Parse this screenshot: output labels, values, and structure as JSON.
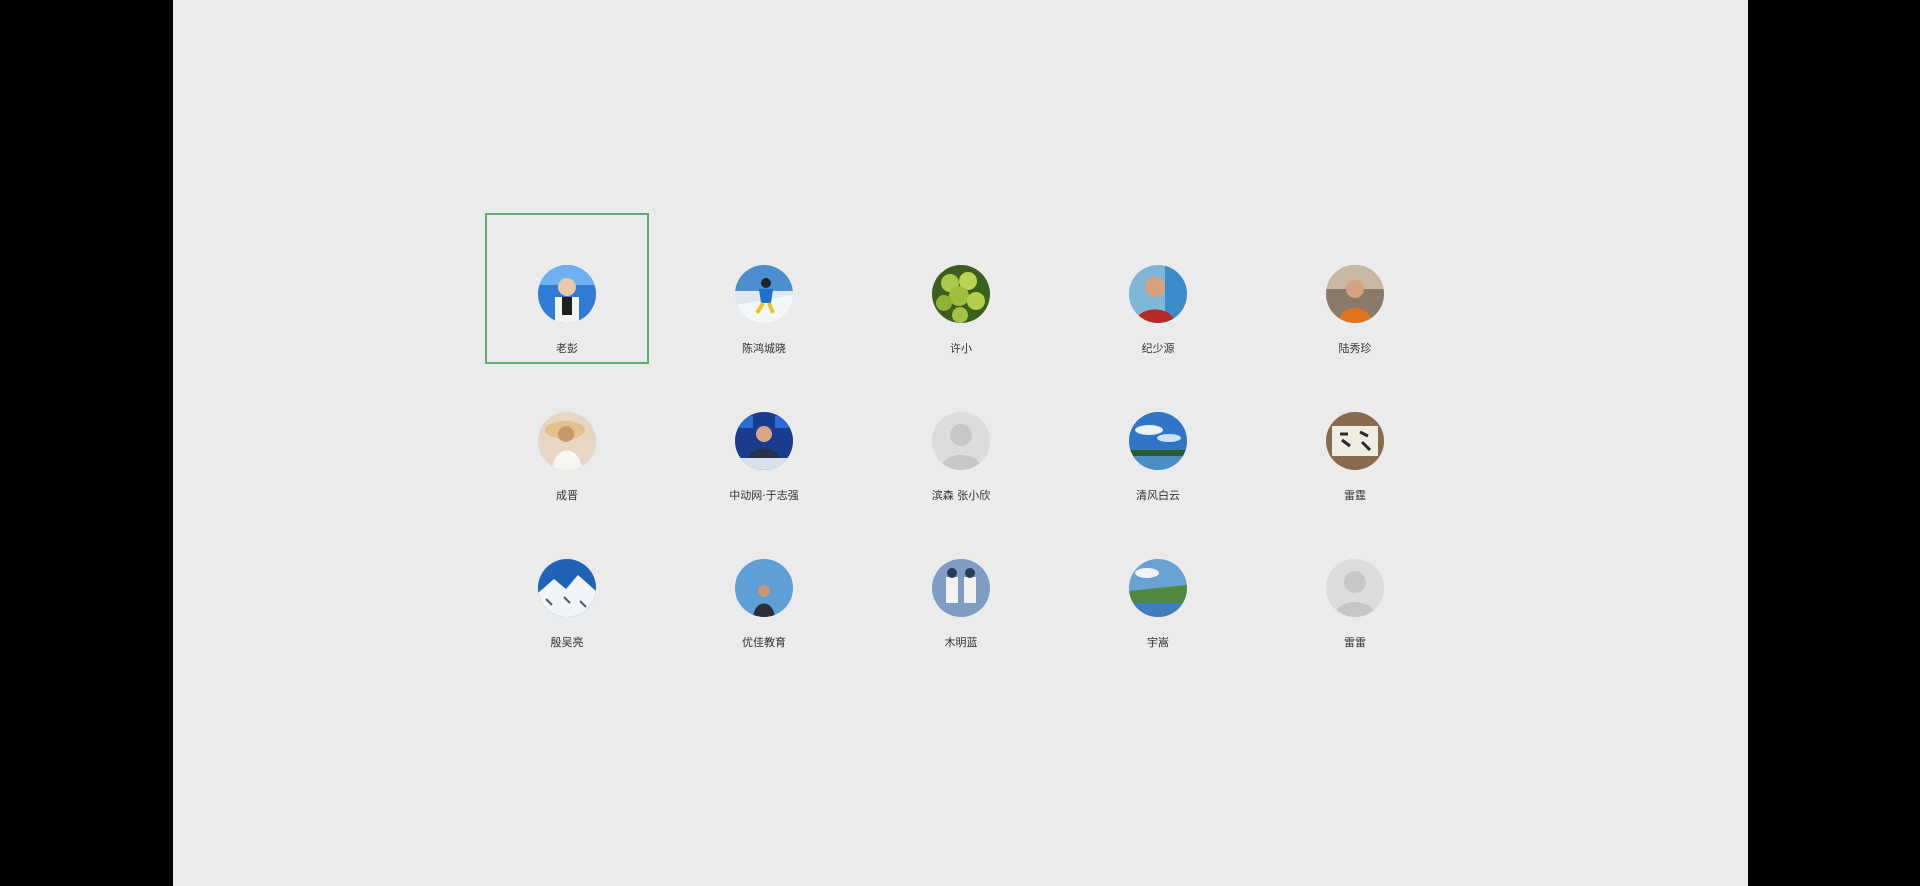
{
  "contacts": [
    {
      "name": "老彭",
      "avatar": "person-portrait-blue"
    },
    {
      "name": "陈鸿城晓",
      "avatar": "skier-snow"
    },
    {
      "name": "许小",
      "avatar": "green-grapes"
    },
    {
      "name": "纪少源",
      "avatar": "man-red-shirt"
    },
    {
      "name": "陆秀珍",
      "avatar": "man-orange-room"
    },
    {
      "name": "成晋",
      "avatar": "woman-sunhat"
    },
    {
      "name": "中动网·于志强",
      "avatar": "man-tv-studio"
    },
    {
      "name": "滨森 张小欣",
      "avatar": "default-user"
    },
    {
      "name": "清风白云",
      "avatar": "blue-sky-lake"
    },
    {
      "name": "雷霆",
      "avatar": "calligraphy-scroll"
    },
    {
      "name": "殷吴亮",
      "avatar": "snowy-mountain"
    },
    {
      "name": "优佳教育",
      "avatar": "person-blue-sky"
    },
    {
      "name": "木明蓝",
      "avatar": "illustrated-figures"
    },
    {
      "name": "宇嵩",
      "avatar": "green-landscape"
    },
    {
      "name": "雷雷",
      "avatar": "default-user"
    }
  ],
  "selected_index": 0,
  "colors": {
    "background": "#ebebeb",
    "frame": "#000000",
    "selection": "#5ab068"
  }
}
